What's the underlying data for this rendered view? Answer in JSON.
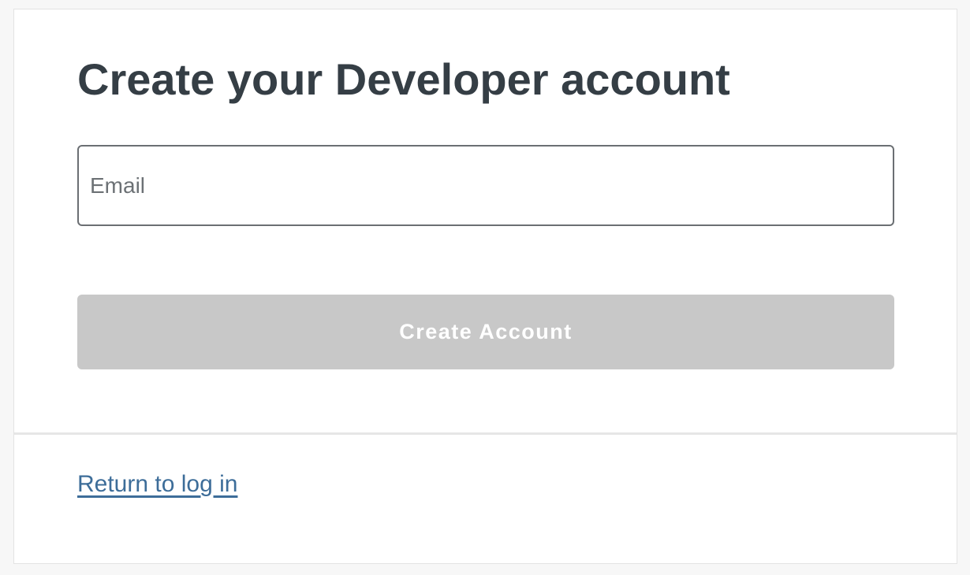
{
  "page": {
    "title": "Create your Developer account"
  },
  "form": {
    "email_placeholder": "Email",
    "email_value": "",
    "submit_label": "Create Account",
    "submit_enabled": false
  },
  "footer": {
    "return_link_label": "Return to log in"
  },
  "colors": {
    "heading": "#353e45",
    "button_disabled_bg": "#c8c8c8",
    "button_text": "#ffffff",
    "link": "#3d6d99",
    "input_border": "#6b6f73"
  }
}
